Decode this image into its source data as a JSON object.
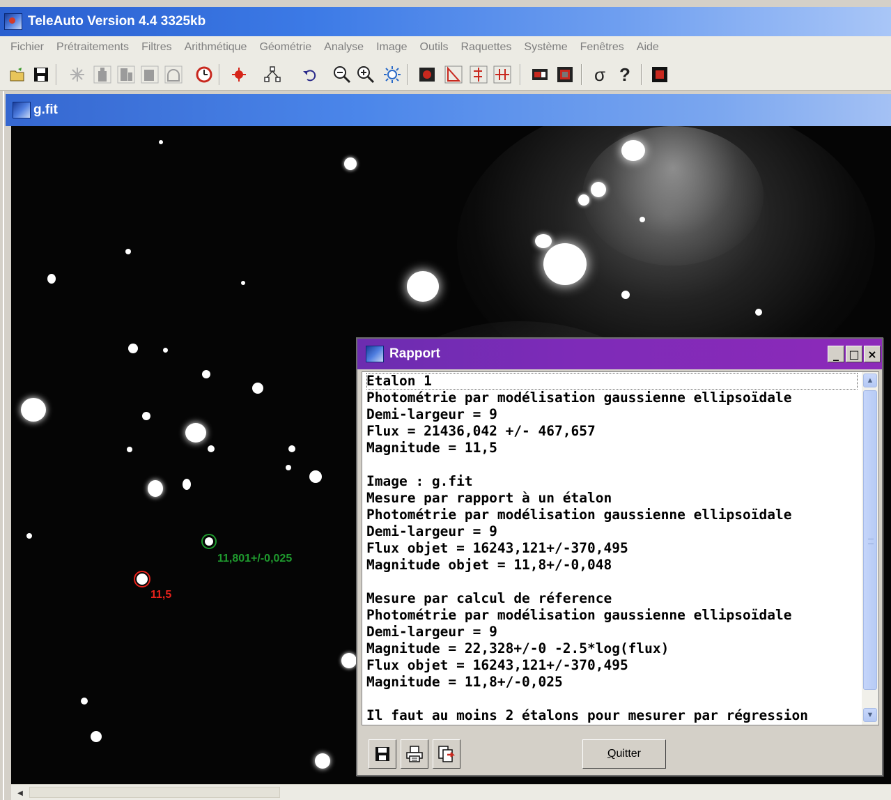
{
  "app": {
    "title": "TeleAuto Version 4.4 3325kb"
  },
  "menu": [
    "Fichier",
    "Prétraitements",
    "Filtres",
    "Arithmétique",
    "Géométrie",
    "Analyse",
    "Image",
    "Outils",
    "Raquettes",
    "Système",
    "Fenêtres",
    "Aide"
  ],
  "toolbar": {
    "icons": [
      "open-icon",
      "save-icon",
      "flake-icon",
      "tool-disabled-1-icon",
      "tool-disabled-2-icon",
      "tool-disabled-3-icon",
      "arch-icon",
      "clock-icon",
      "star-detect-icon",
      "network-icon",
      "undo-icon",
      "zoom-out-icon",
      "zoom-in-icon",
      "brightness-icon",
      "camera-icon",
      "triangle-icon",
      "flip-icon",
      "mirror-icon",
      "film-icon",
      "stack-icon",
      "sigma-icon",
      "help-icon",
      "stop-icon"
    ],
    "sigma_label": "σ",
    "help_label": "?"
  },
  "document": {
    "title": "g.fit"
  },
  "image_annotations": {
    "green_label": "11,801+/-0,025",
    "red_label": "11,5"
  },
  "dialog": {
    "title": "Rapport",
    "minimize_label": "_",
    "maximize_label": "□",
    "close_label": "×",
    "report_lines": [
      "Etalon 1",
      "Photométrie par modélisation gaussienne ellipsoïdale",
      "Demi-largeur = 9",
      "Flux = 21436,042 +/- 467,657",
      "Magnitude = 11,5",
      "",
      "Image : g.fit",
      "Mesure par rapport à un étalon",
      "Photométrie par modélisation gaussienne ellipsoïdale",
      "Demi-largeur = 9",
      "Flux objet = 16243,121+/-370,495",
      "Magnitude objet = 11,8+/-0,048",
      "",
      "Mesure par calcul de réference",
      "Photométrie par modélisation gaussienne ellipsoïdale",
      "Demi-largeur = 9",
      "Magnitude = 22,328+/-0 -2.5*log(flux)",
      "Flux objet = 16243,121+/-370,495",
      "Magnitude = 11,8+/-0,025",
      "",
      "Il faut au moins 2 étalons pour mesurer par régression"
    ],
    "buttons": {
      "quit_first": "Q",
      "quit_rest": "uitter"
    }
  },
  "colors": {
    "titlebar": "#3c7ae6",
    "dialog_titlebar": "#7d2bb8",
    "green_marker": "#1f9a2e",
    "red_marker": "#e8221c"
  }
}
